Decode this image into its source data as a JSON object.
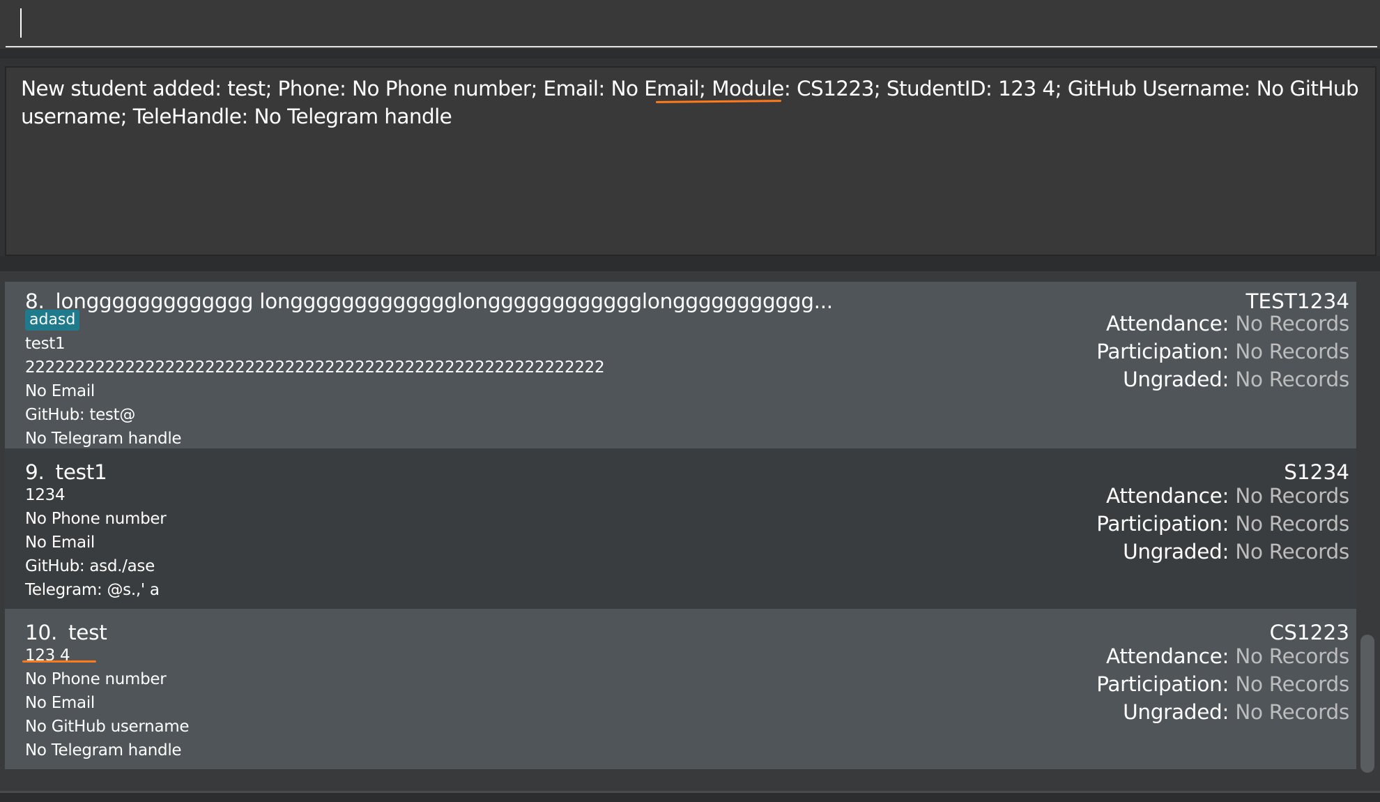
{
  "command": {
    "value": "",
    "placeholder": ""
  },
  "result": {
    "text": "New student added: test; Phone: No Phone number; Email: No Email; Module: CS1223; StudentID: 123 4; GitHub Username: No GitHub username; TeleHandle: No Telegram handle"
  },
  "students": [
    {
      "index": "8.",
      "name": "longgggggggggggg longgggggggggggglongggggggggggglonggggggggggg...",
      "tag": "adasd",
      "lines": [
        "test1",
        "2222222222222222222222222222222222222222222222222222222222",
        "No Email",
        "GitHub: test@",
        "No Telegram handle"
      ],
      "module": "TEST1234",
      "attendance_label": "Attendance:",
      "attendance_value": "No Records",
      "participation_label": "Participation:",
      "participation_value": "No Records",
      "ungraded_label": "Ungraded:",
      "ungraded_value": "No Records"
    },
    {
      "index": "9.",
      "name": "test1",
      "lines": [
        "1234",
        "No Phone number",
        "No Email",
        "GitHub: asd./ase",
        "Telegram: @s.,' a"
      ],
      "module": "S1234",
      "attendance_label": "Attendance:",
      "attendance_value": "No Records",
      "participation_label": "Participation:",
      "participation_value": "No Records",
      "ungraded_label": "Ungraded:",
      "ungraded_value": "No Records"
    },
    {
      "index": "10.",
      "name": "test",
      "lines": [
        "123 4",
        "No Phone number",
        "No Email",
        "No GitHub username",
        "No Telegram handle"
      ],
      "module": "CS1223",
      "attendance_label": "Attendance:",
      "attendance_value": "No Records",
      "participation_label": "Participation:",
      "participation_value": "No Records",
      "ungraded_label": "Ungraded:",
      "ungraded_value": "No Records"
    }
  ],
  "colors": {
    "tag_background": "#1f7a8c",
    "annotation_underline": "#ff7a1c",
    "card_light": "#4f5558",
    "card_dark": "#3a3d3f"
  }
}
